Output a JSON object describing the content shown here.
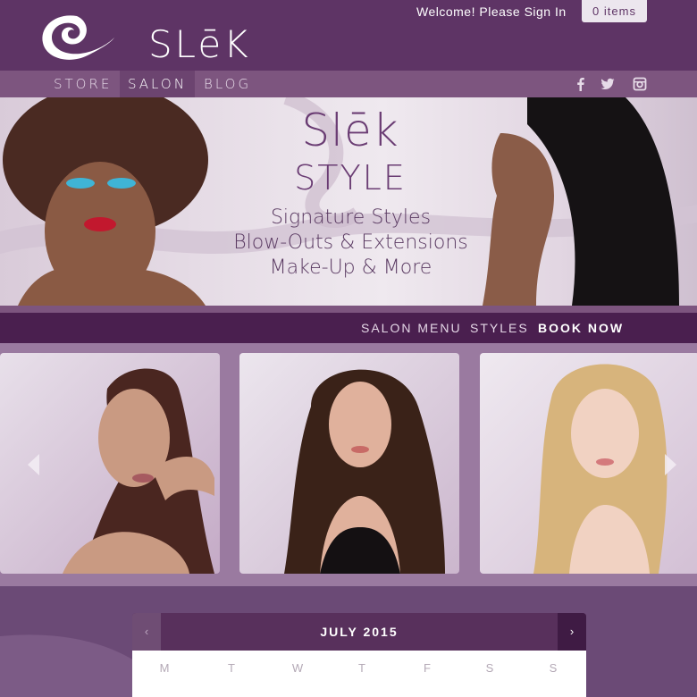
{
  "header": {
    "logo_text": "SLēK",
    "welcome": "Welcome! Please Sign In",
    "cart": "0 items"
  },
  "nav": {
    "items": [
      {
        "label": "STORE",
        "active": false
      },
      {
        "label": "SALON",
        "active": true
      },
      {
        "label": "BLOG",
        "active": false
      }
    ],
    "social": [
      "facebook-icon",
      "twitter-icon",
      "instagram-icon"
    ]
  },
  "hero": {
    "brand": "Slēk",
    "style": "STYLE",
    "lines": [
      "Signature Styles",
      "Blow-Outs & Extensions",
      "Make-Up & More"
    ]
  },
  "subnav": {
    "items": [
      "SALON MENU",
      "STYLES",
      "BOOK NOW"
    ]
  },
  "gallery": {
    "photos": [
      "model-sleek-straight-hair-photo",
      "model-curly-brunette-photo",
      "model-blonde-curls-photo"
    ]
  },
  "calendar": {
    "month": "JULY 2015",
    "prev": "‹",
    "next": "›",
    "weekdays": [
      "M",
      "T",
      "W",
      "T",
      "F",
      "S",
      "S"
    ]
  },
  "colors": {
    "header_bg": "#5e3465",
    "nav_bg": "#7d557f",
    "subnav_bg": "#4a1f4f",
    "accent_text": "#6a3c73"
  }
}
